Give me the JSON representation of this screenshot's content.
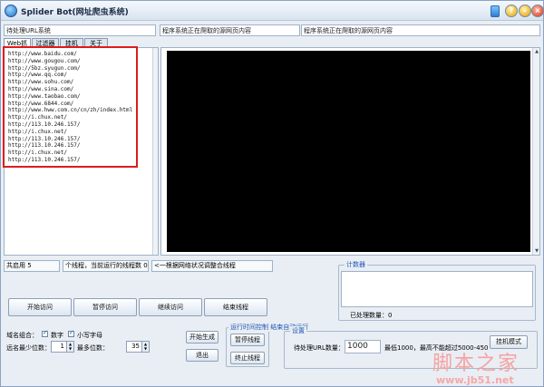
{
  "window": {
    "title": "Splider Bot(网址爬虫系统)"
  },
  "header": {
    "url_field": "待处理URL系统",
    "field_mid": "程序系统正在爬取的源网页内容",
    "field_right": "程序系统正在爬取的源网页内容"
  },
  "tabs": [
    {
      "label": "Web抓取"
    },
    {
      "label": "过滤器"
    },
    {
      "label": "挂机"
    },
    {
      "label": "关于"
    }
  ],
  "url_list": [
    "http://www.baidu.com/",
    "http://www.gougou.com/",
    "http://5bz.syugun.com/",
    "http://www.qq.com/",
    "http://www.sohu.com/",
    "http://www.sina.com/",
    "http://www.taobao.com/",
    "http://www.6844.com/",
    "http://www.hww.com.cn/cn/zh/index.html",
    "http://i.chux.net/",
    "http://113.10.246.157/",
    "http://i.chux.net/",
    "http://113.10.246.157/",
    "http://113.10.246.157/",
    "http://i.chux.net/",
    "http://113.10.246.157/"
  ],
  "status": {
    "total": "共启用 5",
    "threads": "个线程，当前运行的线程数 0 个",
    "hint": "<一根据网络状况调整合线程"
  },
  "counter": {
    "group_label": "计数器",
    "processed": "已处理数量：0"
  },
  "controls": {
    "start": "开始访问",
    "pause": "暂停访问",
    "resume": "继续访问",
    "stop": "结束线程",
    "domain_label": "域名组合：",
    "digits_label": "数字",
    "digits_checked": true,
    "lowercase_label": "小写字母",
    "lowercase_checked": true,
    "min_digits_label": "远名最少位数：",
    "min_digits_value": "1",
    "max_digits_label": "最多位数：",
    "max_digits_value": "35",
    "start_gen": "开始生成",
    "exit": "退出"
  },
  "timer_group": {
    "label": "运行时间控制   结束自动运行",
    "pause_thread": "暂停线程",
    "stop_thread": "终止线程"
  },
  "settings_group": {
    "label": "设置",
    "urls_label": "待处理URL数量：",
    "urls_value": "1000",
    "note": "最低1000，最高不能超过5000-450",
    "hang_mode": "挂机模式"
  },
  "watermark": {
    "cn": "脚本之家",
    "url": "www.jb51.net"
  },
  "colors": {
    "highlight": "#e01b1b",
    "accent": "#1f56b5",
    "screen": "#000000"
  }
}
